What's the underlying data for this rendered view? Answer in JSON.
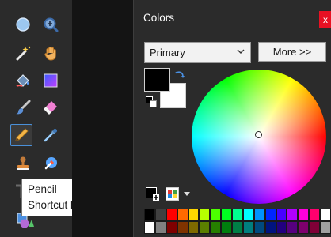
{
  "tools": {
    "items": [
      {
        "name": "ellipse-select",
        "icon": "ellipse-select-icon"
      },
      {
        "name": "zoom",
        "icon": "zoom-icon"
      },
      {
        "name": "magic-wand",
        "icon": "magic-wand-icon"
      },
      {
        "name": "pan",
        "icon": "pan-hand-icon"
      },
      {
        "name": "paint-bucket",
        "icon": "paint-bucket-icon"
      },
      {
        "name": "gradient",
        "icon": "gradient-icon"
      },
      {
        "name": "paintbrush",
        "icon": "paintbrush-icon"
      },
      {
        "name": "eraser",
        "icon": "eraser-icon"
      },
      {
        "name": "pencil",
        "icon": "pencil-icon",
        "selected": true
      },
      {
        "name": "color-picker",
        "icon": "color-picker-icon"
      },
      {
        "name": "clone-stamp",
        "icon": "clone-stamp-icon"
      },
      {
        "name": "recolor",
        "icon": "recolor-icon"
      },
      {
        "name": "text",
        "icon": "text-icon"
      },
      {
        "name": "shapes",
        "icon": "shapes-icon"
      }
    ],
    "tooltip": {
      "title": "Pencil",
      "shortcut": "Shortcut key: P"
    }
  },
  "colors_window": {
    "title": "Colors",
    "close_label": "x",
    "mode_select": {
      "value": "Primary"
    },
    "more_button": "More >>",
    "primary_color": "#000000",
    "secondary_color": "#ffffff",
    "palette": [
      "#000000",
      "#404040",
      "#ff0000",
      "#ff6a00",
      "#ffd800",
      "#b6ff00",
      "#4cff00",
      "#00ff21",
      "#00ff90",
      "#00ffff",
      "#0094ff",
      "#0026ff",
      "#4800ff",
      "#b200ff",
      "#ff00dc",
      "#ff006e",
      "#ffffff",
      "#ffffff",
      "#808080",
      "#7f0000",
      "#7f3300",
      "#7f6a00",
      "#5b7f00",
      "#267f00",
      "#007f0e",
      "#007f46",
      "#007f7f",
      "#004a7f",
      "#00137f",
      "#21007f",
      "#57007f",
      "#7f006e",
      "#7f0037",
      "#a0a0a0"
    ]
  }
}
